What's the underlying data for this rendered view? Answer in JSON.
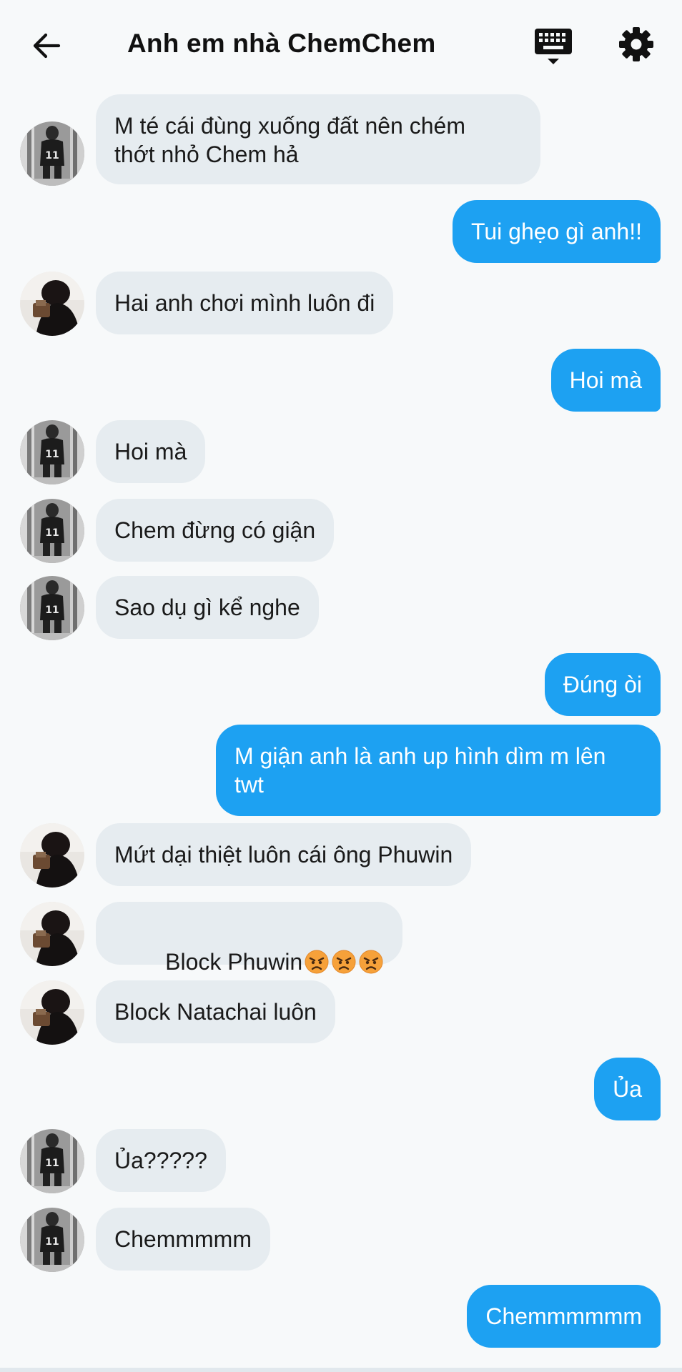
{
  "header": {
    "title": "Anh em nhà ChemChem",
    "back_icon": "arrow-left-icon",
    "keyboard_icon": "keyboard-icon",
    "settings_icon": "gear-icon"
  },
  "colors": {
    "outgoing_bubble": "#1da1f2",
    "incoming_bubble": "#e6ecf0",
    "background": "#f7f9fa"
  },
  "messages": [
    {
      "dir": "in",
      "avatar": "A",
      "text": "M té cái đùng xuống đất nên chém\nthớt nhỏ Chem hả"
    },
    {
      "dir": "out",
      "text": "Tui ghẹo gì anh!!"
    },
    {
      "dir": "in",
      "avatar": "B",
      "text": "Hai anh chơi mình luôn đi"
    },
    {
      "dir": "out",
      "text": "Hoi mà"
    },
    {
      "dir": "in",
      "avatar": "A",
      "text": "Hoi mà"
    },
    {
      "dir": "in",
      "avatar": "A",
      "text": "Chem đừng có giận"
    },
    {
      "dir": "in",
      "avatar": "A",
      "text": "Sao dụ gì kể nghe"
    },
    {
      "dir": "out",
      "text": "Đúng òi"
    },
    {
      "dir": "out",
      "text": "M giận anh là anh up hình dìm m lên\ntwt"
    },
    {
      "dir": "in",
      "avatar": "B",
      "text": "Mứt dại thiệt luôn cái ông Phuwin"
    },
    {
      "dir": "in",
      "avatar": "B",
      "text": "Block Phuwin",
      "emoji": [
        "angry-face-icon",
        "angry-face-icon",
        "angry-face-icon"
      ]
    },
    {
      "dir": "in",
      "avatar": "B",
      "text": "Block Natachai luôn"
    },
    {
      "dir": "out",
      "text": "Ủa"
    },
    {
      "dir": "in",
      "avatar": "A",
      "text": "Ủa?????"
    },
    {
      "dir": "in",
      "avatar": "A",
      "text": "Chemmmmm"
    },
    {
      "dir": "out",
      "text": "Chemmmmmm"
    }
  ]
}
